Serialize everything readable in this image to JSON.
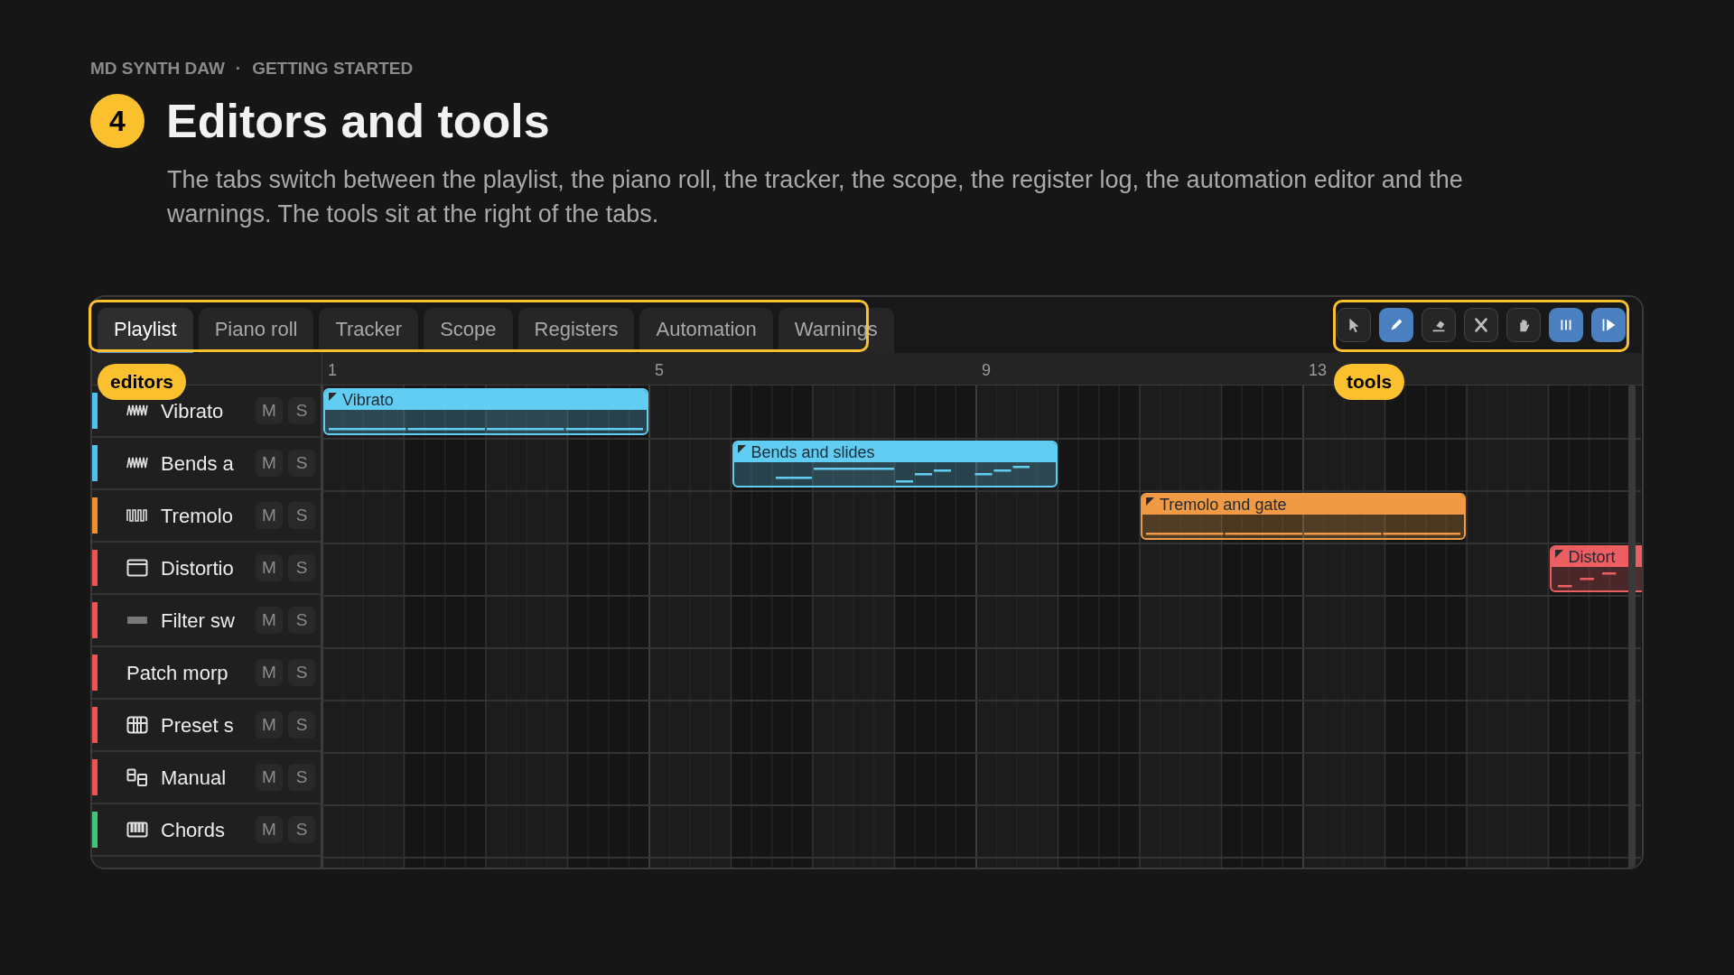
{
  "breadcrumb": {
    "product": "MD SYNTH DAW",
    "separator": "·",
    "section": "GETTING STARTED"
  },
  "step": {
    "number": "4",
    "title": "Editors and tools",
    "description": "The tabs switch between the playlist, the piano roll, the tracker, the scope, the register log, the automation editor and the warnings. The tools sit at the right of the tabs."
  },
  "tabs": [
    {
      "label": "Playlist",
      "selected": true
    },
    {
      "label": "Piano roll",
      "selected": false
    },
    {
      "label": "Tracker",
      "selected": false
    },
    {
      "label": "Scope",
      "selected": false
    },
    {
      "label": "Registers",
      "selected": false
    },
    {
      "label": "Automation",
      "selected": false
    },
    {
      "label": "Warnings",
      "selected": false
    }
  ],
  "tools": [
    {
      "kind": "pointer",
      "active": false
    },
    {
      "kind": "pencil",
      "active": true
    },
    {
      "kind": "eraser",
      "active": false
    },
    {
      "kind": "cut",
      "active": false
    },
    {
      "kind": "hand",
      "active": false
    },
    {
      "kind": "bars",
      "active": true
    },
    {
      "kind": "play",
      "active": true
    }
  ],
  "ruler": [
    "1",
    "5",
    "9",
    "13"
  ],
  "tracks": [
    {
      "name": "Vibrato",
      "color": "#4cc3ee",
      "mute": "M",
      "solo": "S"
    },
    {
      "name": "Bends a",
      "color": "#4cc3ee",
      "mute": "M",
      "solo": "S"
    },
    {
      "name": "Tremolo",
      "color": "#f0902a",
      "mute": "M",
      "solo": "S"
    },
    {
      "name": "Distortio",
      "color": "#ef5350",
      "mute": "M",
      "solo": "S"
    },
    {
      "name": "Filter sw",
      "color": "#ef5350",
      "mute": "M",
      "solo": "S"
    },
    {
      "name": "Patch morp",
      "color": "#ef5350",
      "mute": "M",
      "solo": "S"
    },
    {
      "name": "Preset s",
      "color": "#ef5350",
      "mute": "M",
      "solo": "S"
    },
    {
      "name": "Manual",
      "color": "#ef5350",
      "mute": "M",
      "solo": "S"
    },
    {
      "name": "Chords",
      "color": "#3cc878",
      "mute": "M",
      "solo": "S"
    }
  ],
  "clips": [
    {
      "label": "Vibrato",
      "color": "#62cdf2"
    },
    {
      "label": "Bends and slides",
      "color": "#62cdf2"
    },
    {
      "label": "Tremolo and gate",
      "color": "#f09a45"
    },
    {
      "label": "Distort",
      "color": "#ec5e62"
    }
  ],
  "callouts": [
    {
      "label": "editors"
    },
    {
      "label": "tools"
    }
  ]
}
